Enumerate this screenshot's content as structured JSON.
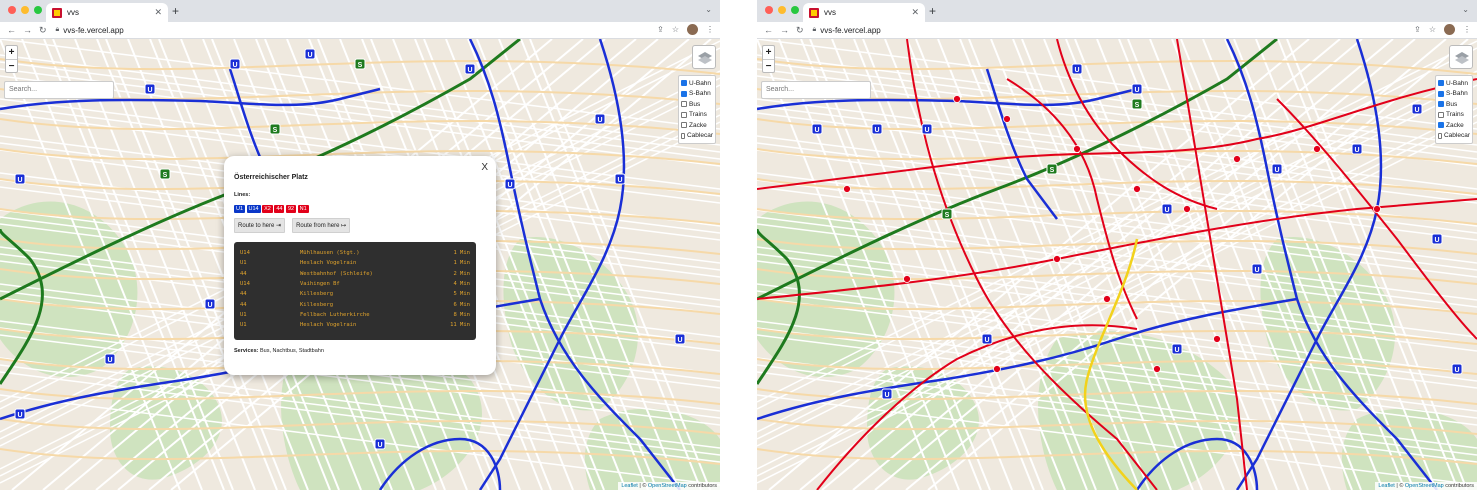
{
  "browser": {
    "tab_title": "vvs",
    "url": "vvs-fe.vercel.app"
  },
  "map": {
    "search_placeholder": "Search...",
    "zoom_in": "+",
    "zoom_out": "−",
    "attribution_leaflet": "Leaflet",
    "attribution_sep": " | © ",
    "attribution_osm": "OpenStreetMap",
    "attribution_tail": " contributors",
    "station_letter_u": "U",
    "station_letter_s": "S"
  },
  "layers_left": [
    {
      "label": "U-Bahn",
      "checked": true
    },
    {
      "label": "S-Bahn",
      "checked": true
    },
    {
      "label": "Bus",
      "checked": false
    },
    {
      "label": "Trains",
      "checked": false
    },
    {
      "label": "Zacke",
      "checked": false
    },
    {
      "label": "Cablecar",
      "checked": false
    }
  ],
  "layers_right": [
    {
      "label": "U-Bahn",
      "checked": true
    },
    {
      "label": "S-Bahn",
      "checked": true
    },
    {
      "label": "Bus",
      "checked": true
    },
    {
      "label": "Trains",
      "checked": false
    },
    {
      "label": "Zacke",
      "checked": true
    },
    {
      "label": "Cablecar",
      "checked": false
    }
  ],
  "popup": {
    "close": "X",
    "title": "Österreichischer Platz",
    "lines_label": "Lines:",
    "lines": [
      {
        "name": "U1",
        "type": "u"
      },
      {
        "name": "U14",
        "type": "u"
      },
      {
        "name": "X2",
        "type": "bus"
      },
      {
        "name": "44",
        "type": "bus"
      },
      {
        "name": "92",
        "type": "bus"
      },
      {
        "name": "N1",
        "type": "bus"
      }
    ],
    "route_to": "Route to here ⇥",
    "route_from": "Route from here ↦",
    "departures": [
      {
        "line": "U14",
        "destination": "Mühlhausen (Stgt.)",
        "time": "1 Min"
      },
      {
        "line": "U1",
        "destination": "Heslach Vogelrain",
        "time": "1 Min"
      },
      {
        "line": "44",
        "destination": "Westbahnhof (Schleife)",
        "time": "2 Min"
      },
      {
        "line": "U14",
        "destination": "Vaihingen Bf",
        "time": "4 Min"
      },
      {
        "line": "44",
        "destination": "Killesberg",
        "time": "5 Min"
      },
      {
        "line": "44",
        "destination": "Killesberg",
        "time": "6 Min"
      },
      {
        "line": "U1",
        "destination": "Fellbach Lutherkirche",
        "time": "8 Min"
      },
      {
        "line": "U1",
        "destination": "Heslach Vogelrain",
        "time": "11 Min"
      }
    ],
    "services_label": "Services:",
    "services_value": " Bus, Nachtbus, Stadtbahn"
  },
  "colors": {
    "ubahn": "#1a2fd6",
    "sbahn": "#1e7a1e",
    "bus": "#e2001a",
    "zacke": "#f2d21b"
  }
}
